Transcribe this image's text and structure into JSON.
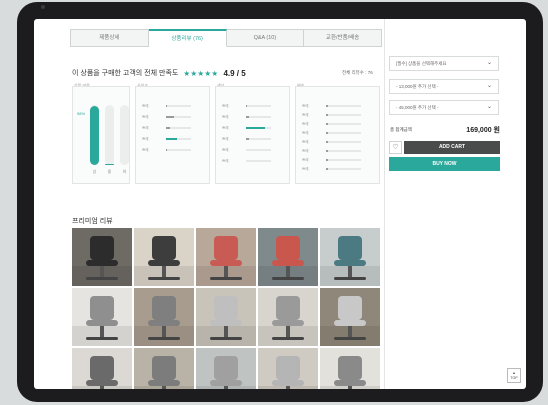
{
  "tabs": [
    "제품상세",
    "상품리뷰 (76)",
    "Q&A (10)",
    "교환/반품/배송"
  ],
  "active_tab": 1,
  "rating": {
    "title": "이 상품을 구매한 고객의 전체 만족도",
    "stars": "★★★★★",
    "score": "4.9 / 5",
    "total_count": "전체 리뷰수 : 76",
    "accent_color": "#2ba89c"
  },
  "stats": {
    "overall": {
      "label": "상품 만족",
      "percent_label": "98%",
      "bars": [
        {
          "label": "상",
          "value": 0.98
        },
        {
          "label": "중",
          "value": 0.02
        },
        {
          "label": "하",
          "value": 0.0
        }
      ]
    },
    "groups": [
      {
        "label": "사이즈",
        "rows": [
          {
            "label": "쁘레",
            "value": 0.05
          },
          {
            "label": "쁘레",
            "value": 0.3
          },
          {
            "label": "쁘레",
            "value": 0.15
          },
          {
            "label": "쁘레",
            "value": 0.45,
            "highlight": true
          },
          {
            "label": "쁘레",
            "value": 0.05
          }
        ]
      },
      {
        "label": "색상",
        "rows": [
          {
            "label": "쁘레",
            "value": 0.05
          },
          {
            "label": "쁘레",
            "value": 0.1
          },
          {
            "label": "쁘레",
            "value": 0.75,
            "highlight": true
          },
          {
            "label": "쁘레",
            "value": 0.1
          },
          {
            "label": "쁘레",
            "value": 0.0
          },
          {
            "label": "쁘레",
            "value": 0.0
          }
        ]
      },
      {
        "label": "배송",
        "rows": [
          {
            "label": "쁘레",
            "value": 0.05
          },
          {
            "label": "쁘레",
            "value": 0.05
          },
          {
            "label": "쁘레",
            "value": 0.05
          },
          {
            "label": "쁘레",
            "value": 0.05
          },
          {
            "label": "쁘레",
            "value": 0.05
          },
          {
            "label": "쁘레",
            "value": 0.05
          },
          {
            "label": "쁘레",
            "value": 0.05
          },
          {
            "label": "쁘레",
            "value": 0.05
          }
        ]
      }
    ]
  },
  "premium_review": {
    "title": "프리미엄 리뷰",
    "photos": [
      {
        "bg": "#6e6a64",
        "chair": "#2c2c2c"
      },
      {
        "bg": "#d9d3c8",
        "chair": "#3d3d3d"
      },
      {
        "bg": "#b8a89a",
        "chair": "#c85c54"
      },
      {
        "bg": "#7f8a8c",
        "chair": "#c9574e"
      },
      {
        "bg": "#c7cdcc",
        "chair": "#4b7a82"
      },
      {
        "bg": "#e6e4e0",
        "chair": "#8f8f8f"
      },
      {
        "bg": "#a89c8e",
        "chair": "#7f7f7f"
      },
      {
        "bg": "#c9c4ba",
        "chair": "#bfbfbf"
      },
      {
        "bg": "#d8d5cf",
        "chair": "#9a9a9a"
      },
      {
        "bg": "#8f8779",
        "chair": "#c8c8c8"
      },
      {
        "bg": "#dcd9d4",
        "chair": "#6a6a6a"
      },
      {
        "bg": "#b9b2a7",
        "chair": "#7c7c7c"
      },
      {
        "bg": "#bfc4c3",
        "chair": "#a0a0a0"
      },
      {
        "bg": "#cfcac2",
        "chair": "#b5b5b5"
      },
      {
        "bg": "#e3e1dc",
        "chair": "#8a8a8a"
      }
    ]
  },
  "purchase": {
    "selects": [
      "[필수] 상품을 선택해주세요",
      "- 13,000원 추가 선택 -",
      "- 45,000원 추가 선택 -"
    ],
    "total_label": "총 합계금액",
    "total_price": "169,000 원",
    "wish_icon": "♡",
    "add_cart": "ADD CART",
    "buy_now": "BUY NOW"
  },
  "top_button": "TOP"
}
